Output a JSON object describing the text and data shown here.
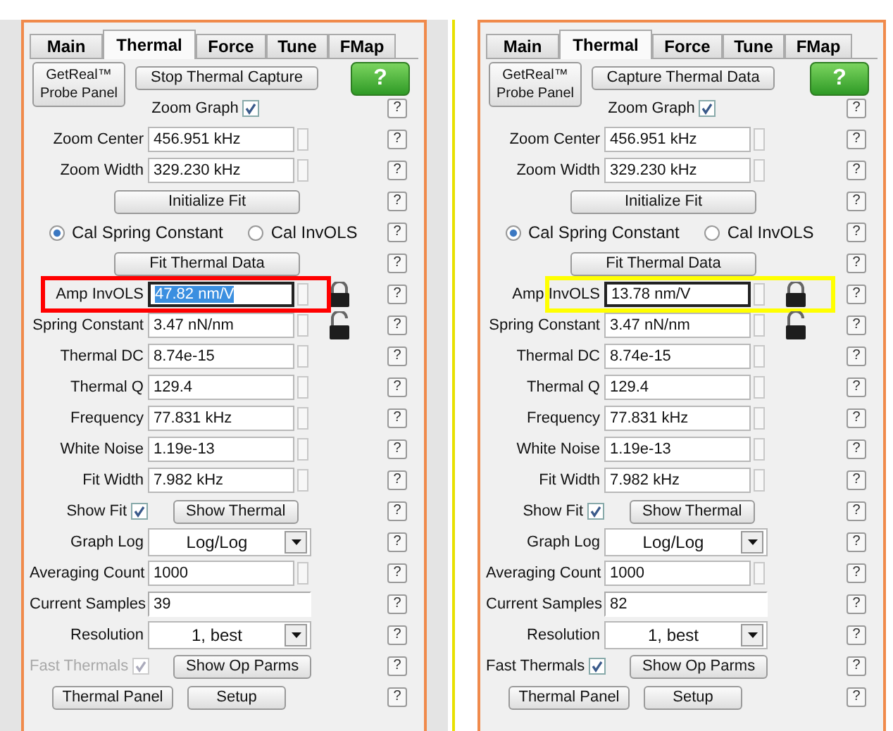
{
  "panels": [
    {
      "tabs": [
        {
          "label": "Main",
          "selected": false
        },
        {
          "label": "Thermal",
          "selected": true
        },
        {
          "label": "Force",
          "selected": false
        },
        {
          "label": "Tune",
          "selected": false
        },
        {
          "label": "FMap",
          "selected": false
        }
      ],
      "probe_button": "GetReal™ Probe Panel",
      "capture_button": "Stop Thermal Capture",
      "help_button": "?",
      "rows": [
        {
          "kind": "check",
          "label": "Zoom Graph",
          "checked": true,
          "disabled": false,
          "help": "?"
        },
        {
          "kind": "spin",
          "label": "Zoom Center",
          "value": "456.951 kHz",
          "help": "?"
        },
        {
          "kind": "spin",
          "label": "Zoom Width",
          "value": "329.230 kHz",
          "help": "?"
        },
        {
          "kind": "button",
          "text": "Initialize Fit",
          "help": "?"
        },
        {
          "kind": "radio",
          "options": [
            {
              "label": "Cal Spring Constant",
              "selected": true
            },
            {
              "label": "Cal InvOLS",
              "selected": false
            }
          ],
          "help": "?"
        },
        {
          "kind": "button",
          "text": "Fit Thermal Data",
          "help": "?"
        },
        {
          "kind": "spin",
          "label": "Amp InvOLS",
          "value": "47.82 nm/V",
          "focused": true,
          "text_selected": true,
          "highlighted": true,
          "color": "#ff0000",
          "locked": true,
          "help": "?"
        },
        {
          "kind": "spin",
          "label": "Spring Constant",
          "value": "3.47 nN/nm",
          "locked": false,
          "help": "?"
        },
        {
          "kind": "spin",
          "label": "Thermal DC",
          "value": "8.74e-15",
          "help": "?"
        },
        {
          "kind": "spin",
          "label": "Thermal Q",
          "value": "129.4",
          "help": "?"
        },
        {
          "kind": "spin",
          "label": "Frequency",
          "value": "77.831 kHz",
          "help": "?"
        },
        {
          "kind": "spin",
          "label": "White Noise",
          "value": "1.19e-13",
          "help": "?"
        },
        {
          "kind": "spin",
          "label": "Fit Width",
          "value": "7.982 kHz",
          "help": "?"
        },
        {
          "kind": "check",
          "label": "Show Fit",
          "checked": true,
          "disabled": false,
          "button": "Show Thermal",
          "help": "?"
        },
        {
          "kind": "select",
          "label": "Graph Log",
          "value": "Log/Log",
          "help": "?"
        },
        {
          "kind": "spin",
          "label": "Averaging Count",
          "value": "1000",
          "help": "?"
        },
        {
          "kind": "readonly",
          "label": "Current Samples",
          "value": "39",
          "help": "?"
        },
        {
          "kind": "select",
          "label": "Resolution",
          "value": "1, best",
          "help": "?"
        },
        {
          "kind": "check",
          "label": "Fast Thermals",
          "checked": true,
          "disabled": true,
          "button": "Show Op Parms",
          "help": "?"
        },
        {
          "kind": "buttons",
          "buttons": [
            "Thermal Panel",
            "Setup"
          ],
          "help": "?"
        }
      ]
    },
    {
      "tabs": [
        {
          "label": "Main",
          "selected": false
        },
        {
          "label": "Thermal",
          "selected": true
        },
        {
          "label": "Force",
          "selected": false
        },
        {
          "label": "Tune",
          "selected": false
        },
        {
          "label": "FMap",
          "selected": false
        }
      ],
      "probe_button": "GetReal™ Probe Panel",
      "capture_button": "Capture Thermal Data",
      "help_button": "?",
      "rows": [
        {
          "kind": "check",
          "label": "Zoom Graph",
          "checked": true,
          "disabled": false,
          "help": "?"
        },
        {
          "kind": "spin",
          "label": "Zoom Center",
          "value": "456.951 kHz",
          "help": "?"
        },
        {
          "kind": "spin",
          "label": "Zoom Width",
          "value": "329.230 kHz",
          "help": "?"
        },
        {
          "kind": "button",
          "text": "Initialize Fit",
          "help": "?"
        },
        {
          "kind": "radio",
          "options": [
            {
              "label": "Cal Spring Constant",
              "selected": true
            },
            {
              "label": "Cal InvOLS",
              "selected": false
            }
          ],
          "help": "?"
        },
        {
          "kind": "button",
          "text": "Fit Thermal Data",
          "help": "?"
        },
        {
          "kind": "spin",
          "label": "Amp InvOLS",
          "value": "13.78 nm/V",
          "focused": true,
          "text_selected": false,
          "highlighted": true,
          "color": "#ffff00",
          "locked": true,
          "help": "?"
        },
        {
          "kind": "spin",
          "label": "Spring Constant",
          "value": "3.47 nN/nm",
          "locked": false,
          "help": "?"
        },
        {
          "kind": "spin",
          "label": "Thermal DC",
          "value": "8.74e-15",
          "help": "?"
        },
        {
          "kind": "spin",
          "label": "Thermal Q",
          "value": "129.4",
          "help": "?"
        },
        {
          "kind": "spin",
          "label": "Frequency",
          "value": "77.831 kHz",
          "help": "?"
        },
        {
          "kind": "spin",
          "label": "White Noise",
          "value": "1.19e-13",
          "help": "?"
        },
        {
          "kind": "spin",
          "label": "Fit Width",
          "value": "7.982 kHz",
          "help": "?"
        },
        {
          "kind": "check",
          "label": "Show Fit",
          "checked": true,
          "disabled": false,
          "button": "Show Thermal",
          "help": "?"
        },
        {
          "kind": "select",
          "label": "Graph Log",
          "value": "Log/Log",
          "help": "?"
        },
        {
          "kind": "spin",
          "label": "Averaging Count",
          "value": "1000",
          "help": "?"
        },
        {
          "kind": "readonly",
          "label": "Current Samples",
          "value": "82",
          "help": "?"
        },
        {
          "kind": "select",
          "label": "Resolution",
          "value": "1, best",
          "help": "?"
        },
        {
          "kind": "check",
          "label": "Fast Thermals",
          "checked": true,
          "disabled": false,
          "button": "Show Op Parms",
          "help": "?"
        },
        {
          "kind": "buttons",
          "buttons": [
            "Thermal Panel",
            "Setup"
          ],
          "help": "?"
        }
      ]
    }
  ]
}
